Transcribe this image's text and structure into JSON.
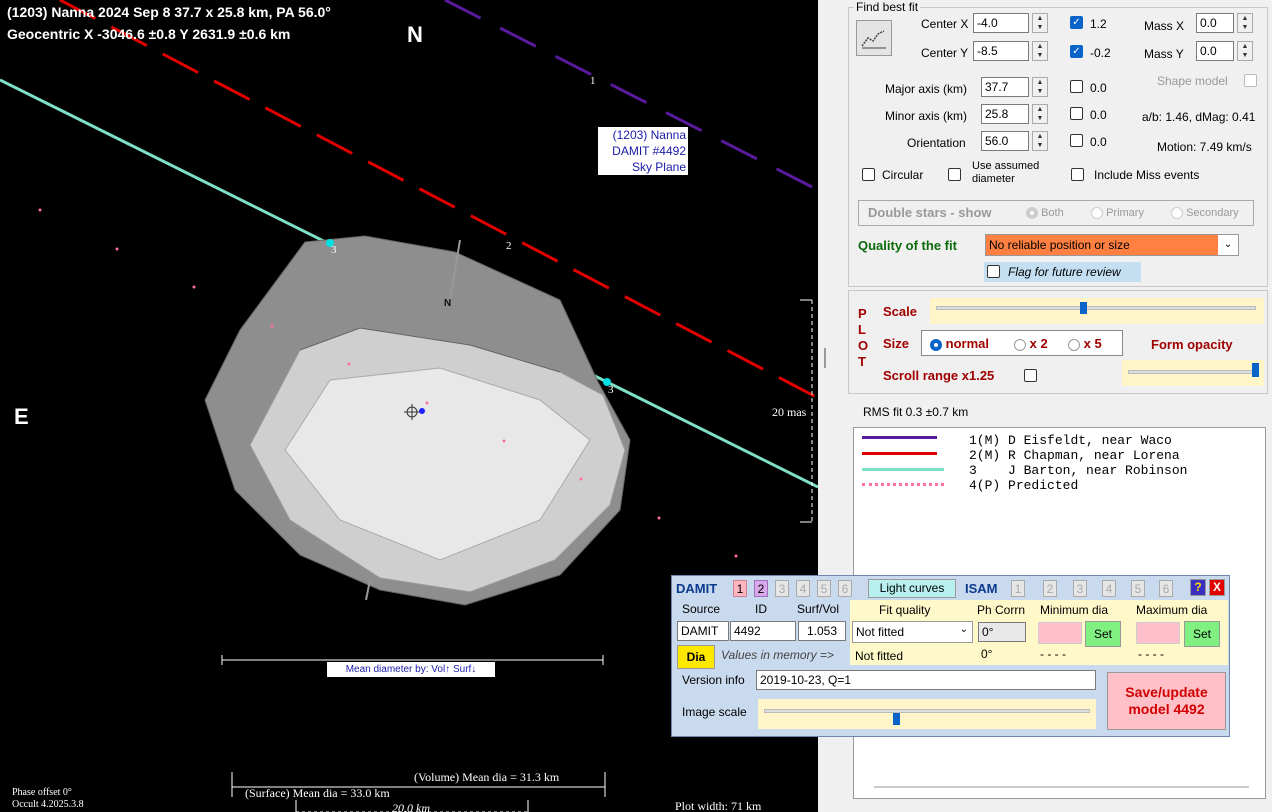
{
  "plot": {
    "title_line1": "(1203) Nanna  2024 Sep 8  37.7 x 25.8 km, PA 56.0°",
    "title_line2": "Geocentric  X  -3046.6 ±0.8  Y 2631.9 ±0.6 km",
    "north": "N",
    "east": "E",
    "sky_label": [
      "(1203) Nanna",
      "DAMIT #4492",
      "Sky Plane"
    ],
    "pole_label": "N",
    "chord_numbers": [
      "1",
      "2",
      "3",
      "3"
    ],
    "scale_label": "20 mas",
    "mean_by": "Mean diameter by: Vol↑ Surf↓",
    "vol_mean": "(Volume) Mean dia = 31.3 km",
    "surf_mean": "(Surface) Mean dia = 33.0 km",
    "scale_km": "20.0 km",
    "phase_offset": "Phase offset 0°",
    "version": "Occult 4.2025.3.8",
    "plot_width": "Plot width: 71 km"
  },
  "fit": {
    "legend": "Find best fit",
    "center_x_label": "Center X",
    "center_x": "-4.0",
    "center_x_step": "1.2",
    "center_y_label": "Center Y",
    "center_y": "-8.5",
    "center_y_step": "-0.2",
    "mass_x_label": "Mass X",
    "mass_x": "0.0",
    "mass_y_label": "Mass Y",
    "mass_y": "0.0",
    "major_label": "Major axis (km)",
    "major": "37.7",
    "major_step": "0.0",
    "minor_label": "Minor axis (km)",
    "minor": "25.8",
    "minor_step": "0.0",
    "orient_label": "Orientation",
    "orient": "56.0",
    "orient_step": "0.0",
    "shape_model": "Shape model",
    "ab": "a/b: 1.46, dMag: 0.41",
    "motion": "Motion: 7.49 km/s",
    "circular": "Circular",
    "assumed": "Use assumed diameter",
    "include_miss": "Include Miss events",
    "double_stars": "Double stars - show",
    "both": "Both",
    "primary": "Primary",
    "secondary": "Secondary",
    "quality_label": "Quality of the fit",
    "quality_value": "No reliable position or size",
    "flag_review": "Flag for future review"
  },
  "plotpanel": {
    "plot_letters": [
      "P",
      "L",
      "O",
      "T"
    ],
    "scale": "Scale",
    "size": "Size",
    "normal": "normal",
    "x2": "x 2",
    "x5": "x 5",
    "form_opacity": "Form opacity",
    "scroll_range": "Scroll range x1.25"
  },
  "rms": "RMS fit 0.3 ±0.7 km",
  "legend_rows": [
    {
      "num": "1(M)",
      "obs": "D Eisfeldt, near Waco",
      "color": "#5a1a9c"
    },
    {
      "num": "2(M)",
      "obs": "R Chapman, near Lorena",
      "color": "#e00000"
    },
    {
      "num": "3",
      "obs": "J Barton, near Robinson",
      "color": "#7fe0c8"
    },
    {
      "num": "4(P)",
      "obs": "Predicted",
      "color": "#ff6fa0"
    }
  ],
  "damit": {
    "title": "DAMIT",
    "tabs": [
      "1",
      "2",
      "3",
      "4",
      "5",
      "6"
    ],
    "light_curves": "Light curves",
    "isam": "ISAM",
    "isam_tabs": [
      "1",
      "2",
      "3",
      "4",
      "5",
      "6"
    ],
    "help": "?",
    "close": "X",
    "source_h": "Source",
    "id_h": "ID",
    "surf_h": "Surf/Vol",
    "fitq_h": "Fit quality",
    "phcorr_h": "Ph Corrn",
    "mindia_h": "Minimum dia",
    "maxdia_h": "Maximum dia",
    "source": "DAMIT",
    "id": "4492",
    "surf": "1.053",
    "fitq": "Not fitted",
    "phcorr": "0°",
    "set1": "Set",
    "set2": "Set",
    "dia": "Dia",
    "mem": "Values in memory =>",
    "mem_fit": "Not fitted",
    "mem_ph": "0°",
    "mem_min": "- - - -",
    "mem_max": "- - - -",
    "version_label": "Version info",
    "version": "2019-10-23, Q=1",
    "image_scale": "Image scale",
    "save": "Save/update model 4492"
  }
}
